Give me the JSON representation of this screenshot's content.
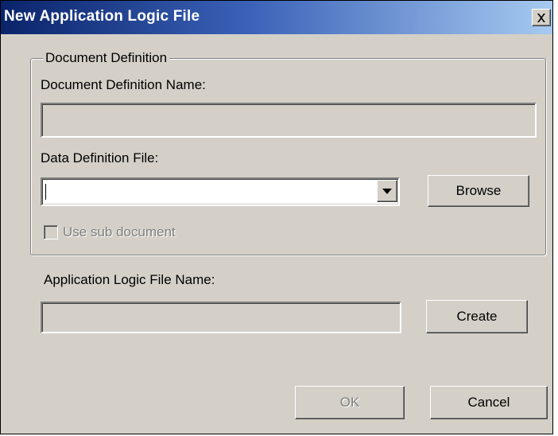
{
  "window": {
    "title": "New Application Logic File",
    "close_icon": "close-icon"
  },
  "document_definition": {
    "group_label": "Document Definition",
    "name_label": "Document Definition Name:",
    "name_value": "",
    "data_file_label": "Data Definition File:",
    "data_file_value": "",
    "browse_label": "Browse",
    "sub_document_label": "Use sub document",
    "sub_document_checked": false
  },
  "application_logic": {
    "file_name_label": "Application Logic File Name:",
    "file_name_value": "",
    "create_label": "Create"
  },
  "footer": {
    "ok_label": "OK",
    "cancel_label": "Cancel"
  },
  "colors": {
    "dialog_face": "#d4d0c8",
    "title_start": "#0a246a",
    "title_end": "#a6caf0",
    "disabled_text": "#808080"
  }
}
